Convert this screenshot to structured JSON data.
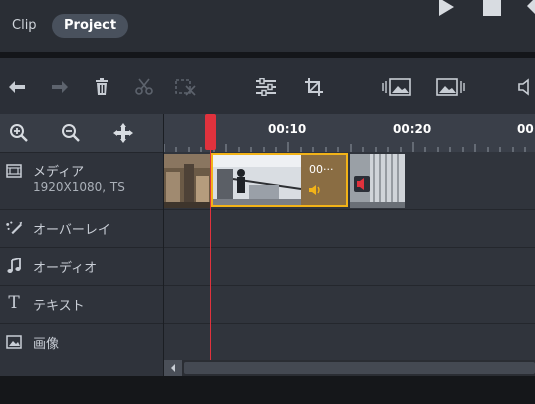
{
  "tabs": {
    "clip": "Clip",
    "project": "Project"
  },
  "ruler": {
    "ticks": [
      "00:10",
      "00:20",
      "00"
    ]
  },
  "tracks": [
    {
      "label": "メディア",
      "sub": "1920X1080, TS",
      "icon": "film-icon"
    },
    {
      "label": "オーバーレイ",
      "icon": "overlay-icon"
    },
    {
      "label": "オーディオ",
      "icon": "music-note-icon"
    },
    {
      "label": "テキスト",
      "icon": "text-icon"
    },
    {
      "label": "画像",
      "icon": "image-icon"
    }
  ],
  "timeline": {
    "selected_clip_label": "00···"
  },
  "colors": {
    "accent_selection": "#f2b318",
    "playhead": "#e0323d"
  }
}
